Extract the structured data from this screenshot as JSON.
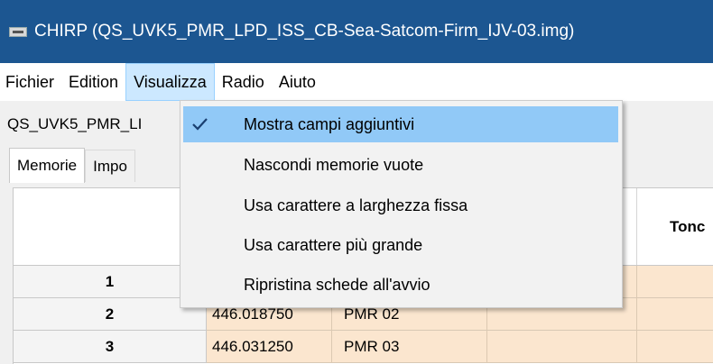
{
  "window": {
    "title": "CHIRP (QS_UVK5_PMR_LPD_ISS_CB-Sea-Satcom-Firm_IJV-03.img)"
  },
  "menubar": {
    "items": [
      {
        "label": "Fichier"
      },
      {
        "label": "Edition"
      },
      {
        "label": "Visualizza"
      },
      {
        "label": "Radio"
      },
      {
        "label": "Aiuto"
      }
    ]
  },
  "file_tab": {
    "label": "QS_UVK5_PMR_LI"
  },
  "tabs": [
    {
      "label": "Memorie"
    },
    {
      "label": "Impo"
    }
  ],
  "grid": {
    "column_header_tone": "Tonc",
    "rows": [
      {
        "num": "1",
        "freq": "",
        "name": ""
      },
      {
        "num": "2",
        "freq": "446.018750",
        "name": "PMR 02"
      },
      {
        "num": "3",
        "freq": "446.031250",
        "name": "PMR 03"
      }
    ]
  },
  "view_menu": {
    "items": [
      {
        "label": "Mostra campi aggiuntivi",
        "checked": true
      },
      {
        "label": "Nascondi memorie vuote",
        "checked": false
      },
      {
        "label": "Usa carattere a larghezza fissa",
        "checked": false
      },
      {
        "label": "Usa carattere più grande",
        "checked": false
      },
      {
        "label": "Ripristina schede all'avvio",
        "checked": false
      }
    ]
  },
  "colors": {
    "titlebar": "#1c5691",
    "menu_active": "#cce8ff",
    "menu_hover": "#91c9f7",
    "row_bg": "#fbe6cf"
  },
  "icons": {
    "app": "app-icon",
    "check": "checkmark-icon"
  }
}
